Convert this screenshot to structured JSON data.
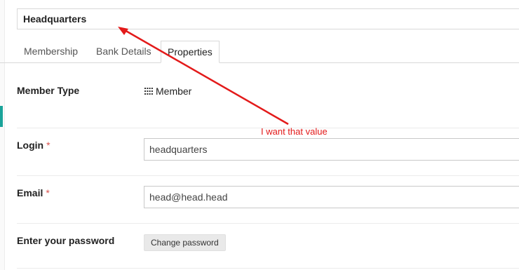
{
  "record": {
    "title": "Headquarters"
  },
  "tabs": [
    {
      "label": "Membership"
    },
    {
      "label": "Bank Details"
    },
    {
      "label": "Properties"
    }
  ],
  "form": {
    "member_type": {
      "label": "Member Type",
      "value": "Member",
      "icon": "grid-icon"
    },
    "login": {
      "label": "Login",
      "required_mark": "*",
      "value": "headquarters"
    },
    "email": {
      "label": "Email",
      "required_mark": "*",
      "value": "head@head.head"
    },
    "password": {
      "label": "Enter your password",
      "button_label": "Change password"
    }
  },
  "annotation": {
    "text": "I want that value",
    "color": "#e31a1a"
  },
  "colors": {
    "accent": "#1aa39a",
    "required": "#d9534f"
  }
}
